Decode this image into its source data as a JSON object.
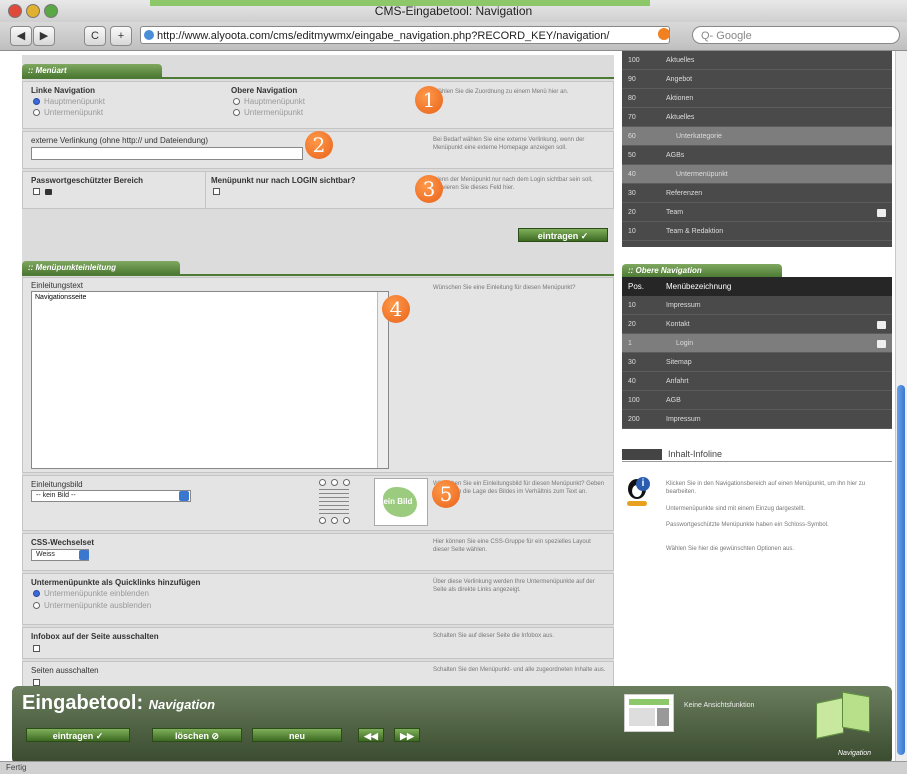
{
  "window": {
    "title": "CMS-Eingabetool: Navigation"
  },
  "toolbar": {
    "back": "◀",
    "forward": "▶",
    "reload": "C",
    "add": "+",
    "url": "http://www.alyoota.com/cms/editmywmx/eingabe_navigation.php?RECORD_KEY/navigation/",
    "search_placeholder": "Q- Google"
  },
  "menu": {
    "tab": ":: Menüart",
    "left_nav_label": "Linke Navigation",
    "left_opt1": "Hauptmenüpunkt",
    "left_opt2": "Untermenüpunkt",
    "top_nav_label": "Obere Navigation",
    "top_opt1": "Hauptmenüpunkt",
    "top_opt2": "Untermenüpunkt",
    "help1": "Wählen Sie die Zuordnung zu einem Menü hier an.",
    "ext_link_label": "externe Verlinkung (ohne http:// und Dateiendung)",
    "help2": "Bei Bedarf wählen Sie eine externe Verlinkung, wenn der Menüpunkt eine externe Homepage anzeigen soll.",
    "pw_label": "Passwortgeschützter Bereich",
    "login_label": "Menüpunkt nur nach LOGIN sichtbar?",
    "help3": "Wenn der Menüpunkt nur nach dem Login sichtbar sein soll, aktivieren Sie dieses Feld hier.",
    "submit": "eintragen ✓"
  },
  "intro": {
    "tab": ":: Menüpunkteinleitung",
    "text_label": "Einleitungstext",
    "text_value": "Navigationsseite",
    "help": "Wünschen Sie eine Einleitung für diesen Menüpunkt?",
    "img_label": "Einleitungsbild",
    "img_select": "-- kein Bild --",
    "img_preview": "kein Bild",
    "img_help": "Wünschen Sie ein Einleitungsbild für diesen Menüpunkt? Geben Sie zudem die Lage des Bildes im Verhältnis zum Text an.",
    "css_label": "CSS-Wechselset",
    "css_select": "Weiss",
    "css_help": "Hier können Sie eine CSS-Gruppe für ein spezielles Layout dieser Seite wählen.",
    "quick_label": "Untermenüpunkte als Quicklinks hinzufügen",
    "quick_opt1": "Untermenüpunkte einblenden",
    "quick_opt2": "Untermenüpunkte ausblenden",
    "quick_help": "Über diese Verlinkung werden Ihre Untermenüpunkte auf der Seite als direkte Links angezeigt.",
    "infobox_label": "Infobox auf der Seite ausschalten",
    "infobox_help": "Schalten Sie auf dieser Seite die Infobox aus.",
    "hide_label": "Seiten ausschalten",
    "hide_help": "Schalten Sie den Menüpunkt- und alle zugeordneten Inhalte aus."
  },
  "callouts": [
    "1",
    "2",
    "3",
    "3",
    "4",
    "5"
  ],
  "left_nav": {
    "rows": [
      {
        "pos": "100",
        "name": "Aktuelles"
      },
      {
        "pos": "90",
        "name": "Angebot"
      },
      {
        "pos": "80",
        "name": "Aktionen"
      },
      {
        "pos": "70",
        "name": "Aktuelles"
      },
      {
        "pos": "60",
        "name": "Unterkategorie"
      },
      {
        "pos": "50",
        "name": "AGBs"
      },
      {
        "pos": "40",
        "name": "Untermenüpunkt"
      },
      {
        "pos": "30",
        "name": "Referenzen"
      },
      {
        "pos": "20",
        "name": "Team"
      },
      {
        "pos": "10",
        "name": "Team & Redaktion"
      }
    ]
  },
  "top_nav": {
    "tab": ":: Obere Navigation",
    "col_pos": "Pos.",
    "col_name": "Menübezeichnung",
    "rows": [
      {
        "pos": "10",
        "name": "Impressum"
      },
      {
        "pos": "20",
        "name": "Kontakt"
      },
      {
        "pos": "1",
        "name": "Login"
      },
      {
        "pos": "30",
        "name": "Sitemap"
      },
      {
        "pos": "40",
        "name": "Anfahrt"
      },
      {
        "pos": "100",
        "name": "AGB"
      },
      {
        "pos": "200",
        "name": "Impressum"
      }
    ]
  },
  "info": {
    "title": "Inhalt-Infoline",
    "lines": [
      "Klicken Sie in den Navigationsbereich auf einen Menüpunkt, um ihn hier zu bearbeiten.",
      "Untermenüpunkte sind mit einem Einzug dargestellt.",
      "Passwortgeschützte Menüpunkte haben ein Schloss-Symbol.",
      "Wählen Sie hier die gewünschten Optionen aus."
    ]
  },
  "footer": {
    "title": "Eingabetool:",
    "subtitle": "Navigation",
    "btn_save": "eintragen ✓",
    "btn_delete": "löschen ⊘",
    "btn_new": "neu",
    "btn_prev": "◀◀",
    "btn_next": "▶▶",
    "preview_text": "Keine Ansichtsfunktion",
    "book_label": "Navigation"
  },
  "status": {
    "text": "Fertig"
  }
}
